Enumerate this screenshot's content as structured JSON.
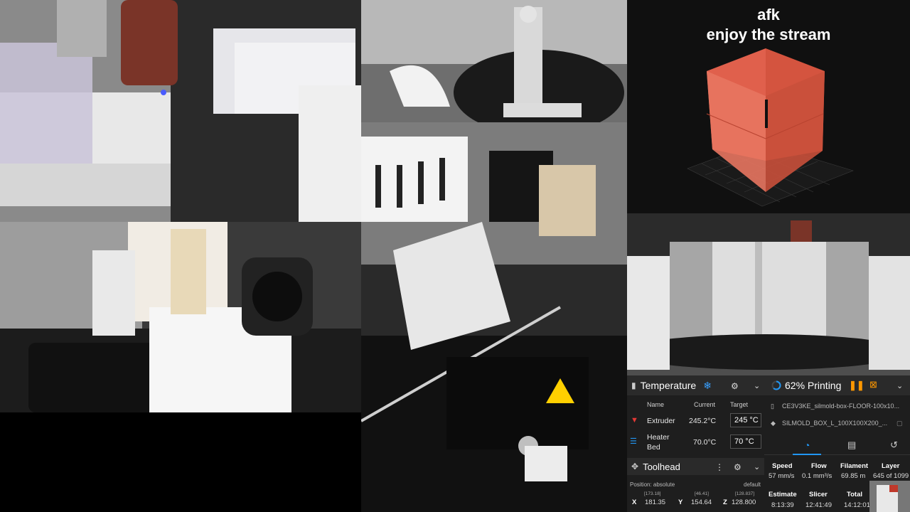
{
  "overlay": {
    "line1": "afk",
    "line2": "enjoy the stream"
  },
  "temperature": {
    "title": "Temperature",
    "col_name": "Name",
    "col_current": "Current",
    "col_target": "Target",
    "extruder_label": "Extruder",
    "extruder_current": "245.2°C",
    "extruder_target": "245 °C",
    "bed_label_1": "Heater",
    "bed_label_2": "Bed",
    "bed_current": "70.0°C",
    "bed_target": "70 °C"
  },
  "toolhead": {
    "title": "Toolhead",
    "position_mode": "Position: absolute",
    "profile": "default",
    "x_label": "X",
    "x_value": "181.35",
    "x_hint": "[173.18]",
    "y_label": "Y",
    "y_value": "154.64",
    "y_hint": "[46.41]",
    "z_label": "Z",
    "z_value": "128.800",
    "z_hint": "[128.837]"
  },
  "status": {
    "title": "62% Printing",
    "progress_percent": 62,
    "file": "CE3V3KE_silmold-box-FLOOR-100x10...",
    "object": "SILMOLD_BOX_L_100X100X200_...",
    "speed_label": "Speed",
    "speed_value": "57 mm/s",
    "flow_label": "Flow",
    "flow_value": "0.1 mm³/s",
    "filament_label": "Filament",
    "filament_value": "69.85 m",
    "layer_label": "Layer",
    "layer_value": "645 of 1099",
    "estimate_label": "Estimate",
    "estimate_value": "8:13:39",
    "slicer_label": "Slicer",
    "slicer_value": "12:41:49",
    "total_label": "Total",
    "total_value": "14:12:01"
  },
  "colors": {
    "accent": "#2196f3",
    "pause": "#ff9800",
    "model": "#e0604c",
    "extruder_icon": "#e53935",
    "bed_icon": "#2196f3"
  }
}
